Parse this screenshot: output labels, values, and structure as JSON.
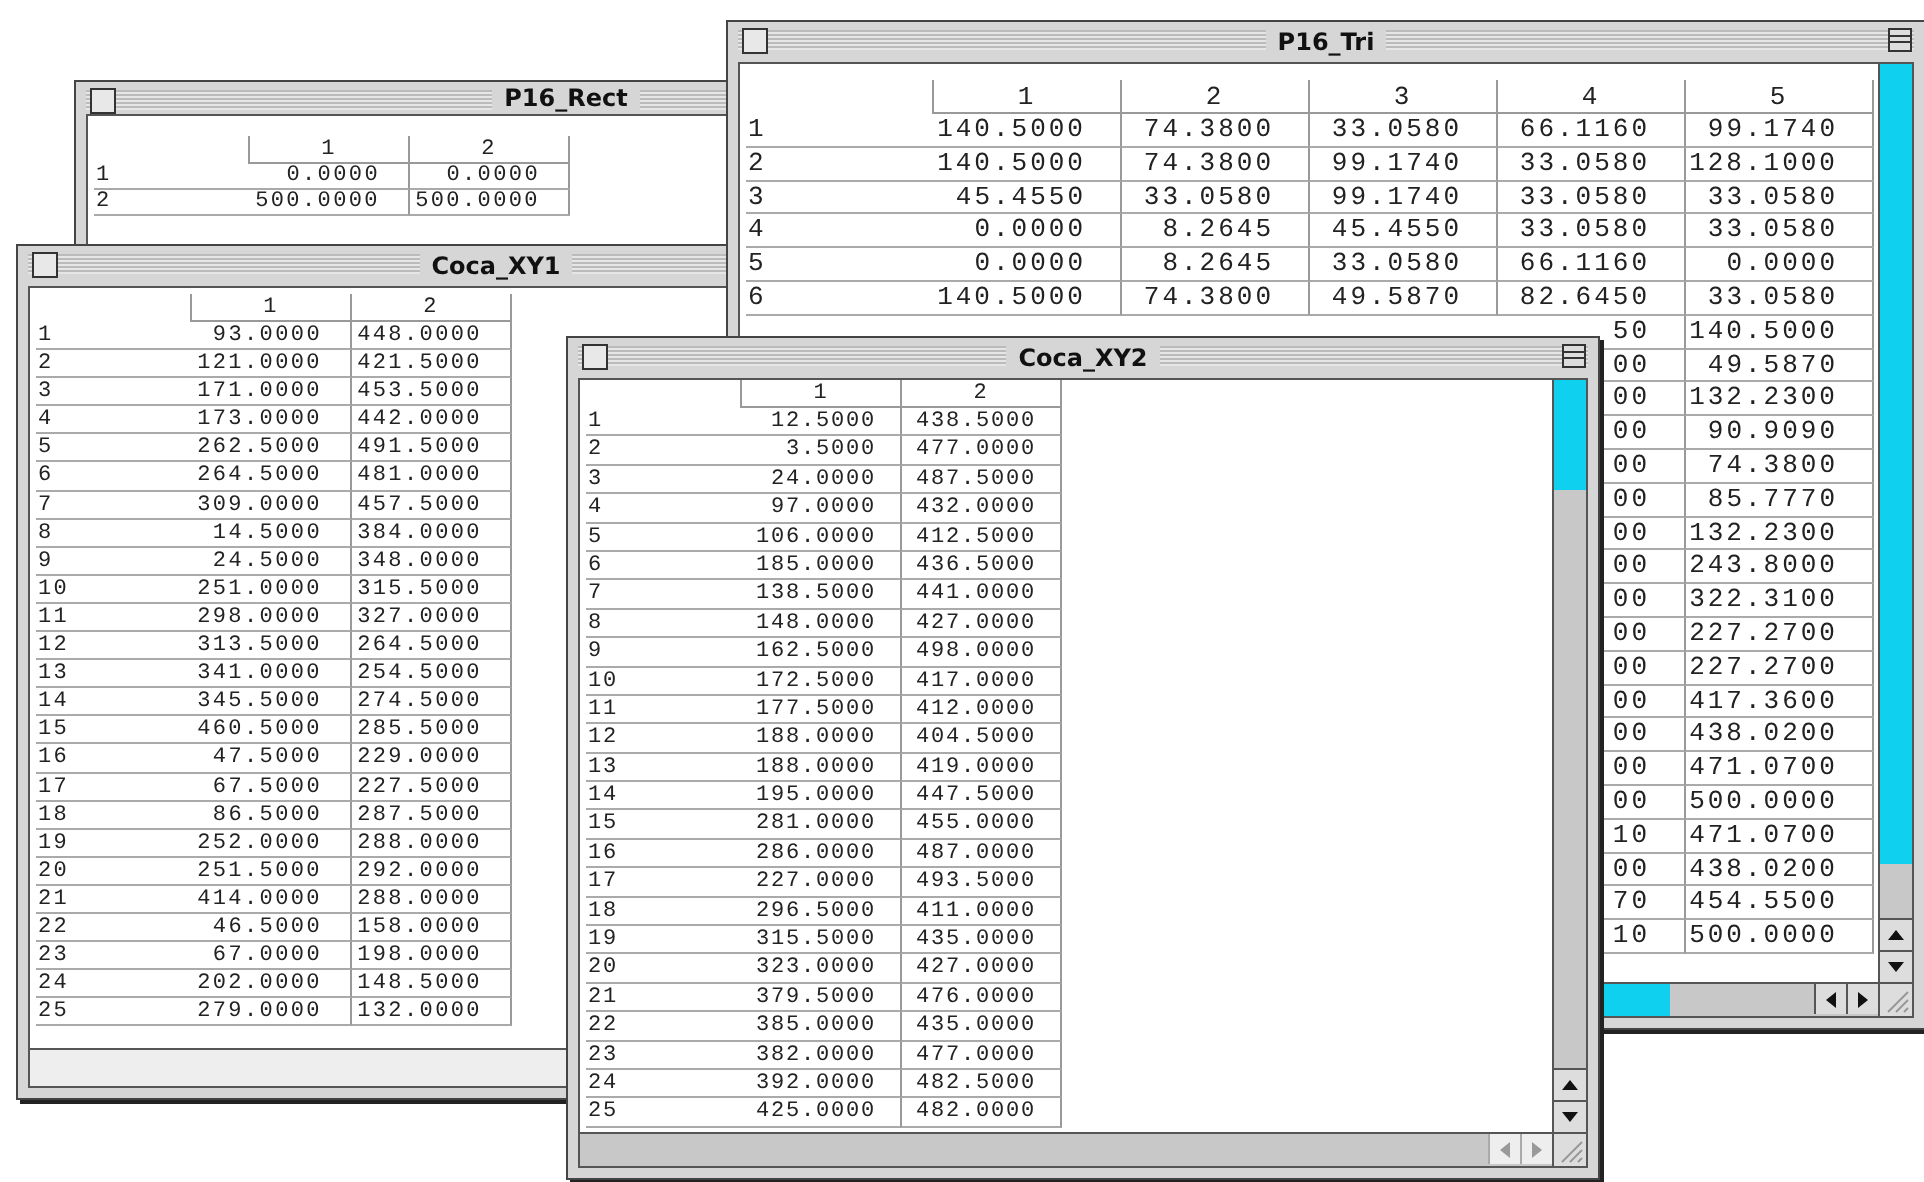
{
  "windows": [
    {
      "title": "P16_Rect",
      "columns": [
        "1",
        "2"
      ],
      "rows": [
        {
          "label": "1",
          "cells": [
            "0.0000",
            "0.0000"
          ]
        },
        {
          "label": "2",
          "cells": [
            "500.0000",
            "500.0000"
          ]
        }
      ]
    },
    {
      "title": "Coca_XY1",
      "columns": [
        "1",
        "2"
      ],
      "rows": [
        {
          "label": "1",
          "cells": [
            "93.0000",
            "448.0000"
          ]
        },
        {
          "label": "2",
          "cells": [
            "121.0000",
            "421.5000"
          ]
        },
        {
          "label": "3",
          "cells": [
            "171.0000",
            "453.5000"
          ]
        },
        {
          "label": "4",
          "cells": [
            "173.0000",
            "442.0000"
          ]
        },
        {
          "label": "5",
          "cells": [
            "262.5000",
            "491.5000"
          ]
        },
        {
          "label": "6",
          "cells": [
            "264.5000",
            "481.0000"
          ]
        },
        {
          "label": "7",
          "cells": [
            "309.0000",
            "457.5000"
          ]
        },
        {
          "label": "8",
          "cells": [
            "14.5000",
            "384.0000"
          ]
        },
        {
          "label": "9",
          "cells": [
            "24.5000",
            "348.0000"
          ]
        },
        {
          "label": "10",
          "cells": [
            "251.0000",
            "315.5000"
          ]
        },
        {
          "label": "11",
          "cells": [
            "298.0000",
            "327.0000"
          ]
        },
        {
          "label": "12",
          "cells": [
            "313.5000",
            "264.5000"
          ]
        },
        {
          "label": "13",
          "cells": [
            "341.0000",
            "254.5000"
          ]
        },
        {
          "label": "14",
          "cells": [
            "345.5000",
            "274.5000"
          ]
        },
        {
          "label": "15",
          "cells": [
            "460.5000",
            "285.5000"
          ]
        },
        {
          "label": "16",
          "cells": [
            "47.5000",
            "229.0000"
          ]
        },
        {
          "label": "17",
          "cells": [
            "67.5000",
            "227.5000"
          ]
        },
        {
          "label": "18",
          "cells": [
            "86.5000",
            "287.5000"
          ]
        },
        {
          "label": "19",
          "cells": [
            "252.0000",
            "288.0000"
          ]
        },
        {
          "label": "20",
          "cells": [
            "251.5000",
            "292.0000"
          ]
        },
        {
          "label": "21",
          "cells": [
            "414.0000",
            "288.0000"
          ]
        },
        {
          "label": "22",
          "cells": [
            "46.5000",
            "158.0000"
          ]
        },
        {
          "label": "23",
          "cells": [
            "67.0000",
            "198.0000"
          ]
        },
        {
          "label": "24",
          "cells": [
            "202.0000",
            "148.5000"
          ]
        },
        {
          "label": "25",
          "cells": [
            "279.0000",
            "132.0000"
          ]
        }
      ]
    },
    {
      "title": "P16_Tri",
      "columns": [
        "1",
        "2",
        "3",
        "4",
        "5"
      ],
      "rows": [
        {
          "label": "1",
          "cells": [
            "140.5000",
            "74.3800",
            "33.0580",
            "66.1160",
            "99.1740"
          ]
        },
        {
          "label": "2",
          "cells": [
            "140.5000",
            "74.3800",
            "99.1740",
            "33.0580",
            "128.1000"
          ]
        },
        {
          "label": "3",
          "cells": [
            "45.4550",
            "33.0580",
            "99.1740",
            "33.0580",
            "33.0580"
          ]
        },
        {
          "label": "4",
          "cells": [
            "0.0000",
            "8.2645",
            "45.4550",
            "33.0580",
            "33.0580"
          ]
        },
        {
          "label": "5",
          "cells": [
            "0.0000",
            "8.2645",
            "33.0580",
            "66.1160",
            "0.0000"
          ]
        },
        {
          "label": "6",
          "cells": [
            "140.5000",
            "74.3800",
            "49.5870",
            "82.6450",
            "33.0580"
          ]
        }
      ],
      "partly_hidden_rows": [
        {
          "column_4": "50",
          "column_5": "140.5000"
        },
        {
          "column_4": "00",
          "column_5": "49.5870"
        },
        {
          "column_4": "00",
          "column_5": "132.2300"
        },
        {
          "column_4": "00",
          "column_5": "90.9090"
        },
        {
          "column_4": "00",
          "column_5": "74.3800"
        },
        {
          "column_4": "00",
          "column_5": "85.7770"
        },
        {
          "column_4": "00",
          "column_5": "132.2300"
        },
        {
          "column_4": "00",
          "column_5": "243.8000"
        },
        {
          "column_4": "00",
          "column_5": "322.3100"
        },
        {
          "column_4": "00",
          "column_5": "227.2700"
        },
        {
          "column_4": "00",
          "column_5": "227.2700"
        },
        {
          "column_4": "00",
          "column_5": "417.3600"
        },
        {
          "column_4": "00",
          "column_5": "438.0200"
        },
        {
          "column_4": "00",
          "column_5": "471.0700"
        },
        {
          "column_4": "00",
          "column_5": "500.0000"
        },
        {
          "column_4": "10",
          "column_5": "471.0700"
        },
        {
          "column_4": "00",
          "column_5": "438.0200"
        },
        {
          "column_4": "70",
          "column_5": "454.5500"
        },
        {
          "column_4": "10",
          "column_5": "500.0000"
        }
      ]
    },
    {
      "title": "Coca_XY2",
      "columns": [
        "1",
        "2"
      ],
      "rows": [
        {
          "label": "1",
          "cells": [
            "12.5000",
            "438.5000"
          ]
        },
        {
          "label": "2",
          "cells": [
            "3.5000",
            "477.0000"
          ]
        },
        {
          "label": "3",
          "cells": [
            "24.0000",
            "487.5000"
          ]
        },
        {
          "label": "4",
          "cells": [
            "97.0000",
            "432.0000"
          ]
        },
        {
          "label": "5",
          "cells": [
            "106.0000",
            "412.5000"
          ]
        },
        {
          "label": "6",
          "cells": [
            "185.0000",
            "436.5000"
          ]
        },
        {
          "label": "7",
          "cells": [
            "138.5000",
            "441.0000"
          ]
        },
        {
          "label": "8",
          "cells": [
            "148.0000",
            "427.0000"
          ]
        },
        {
          "label": "9",
          "cells": [
            "162.5000",
            "498.0000"
          ]
        },
        {
          "label": "10",
          "cells": [
            "172.5000",
            "417.0000"
          ]
        },
        {
          "label": "11",
          "cells": [
            "177.5000",
            "412.0000"
          ]
        },
        {
          "label": "12",
          "cells": [
            "188.0000",
            "404.5000"
          ]
        },
        {
          "label": "13",
          "cells": [
            "188.0000",
            "419.0000"
          ]
        },
        {
          "label": "14",
          "cells": [
            "195.0000",
            "447.5000"
          ]
        },
        {
          "label": "15",
          "cells": [
            "281.0000",
            "455.0000"
          ]
        },
        {
          "label": "16",
          "cells": [
            "286.0000",
            "487.0000"
          ]
        },
        {
          "label": "17",
          "cells": [
            "227.0000",
            "493.5000"
          ]
        },
        {
          "label": "18",
          "cells": [
            "296.5000",
            "411.0000"
          ]
        },
        {
          "label": "19",
          "cells": [
            "315.5000",
            "435.0000"
          ]
        },
        {
          "label": "20",
          "cells": [
            "323.0000",
            "427.0000"
          ]
        },
        {
          "label": "21",
          "cells": [
            "379.5000",
            "476.0000"
          ]
        },
        {
          "label": "22",
          "cells": [
            "385.0000",
            "435.0000"
          ]
        },
        {
          "label": "23",
          "cells": [
            "382.0000",
            "477.0000"
          ]
        },
        {
          "label": "24",
          "cells": [
            "392.0000",
            "482.5000"
          ]
        },
        {
          "label": "25",
          "cells": [
            "425.0000",
            "482.0000"
          ]
        }
      ]
    }
  ]
}
